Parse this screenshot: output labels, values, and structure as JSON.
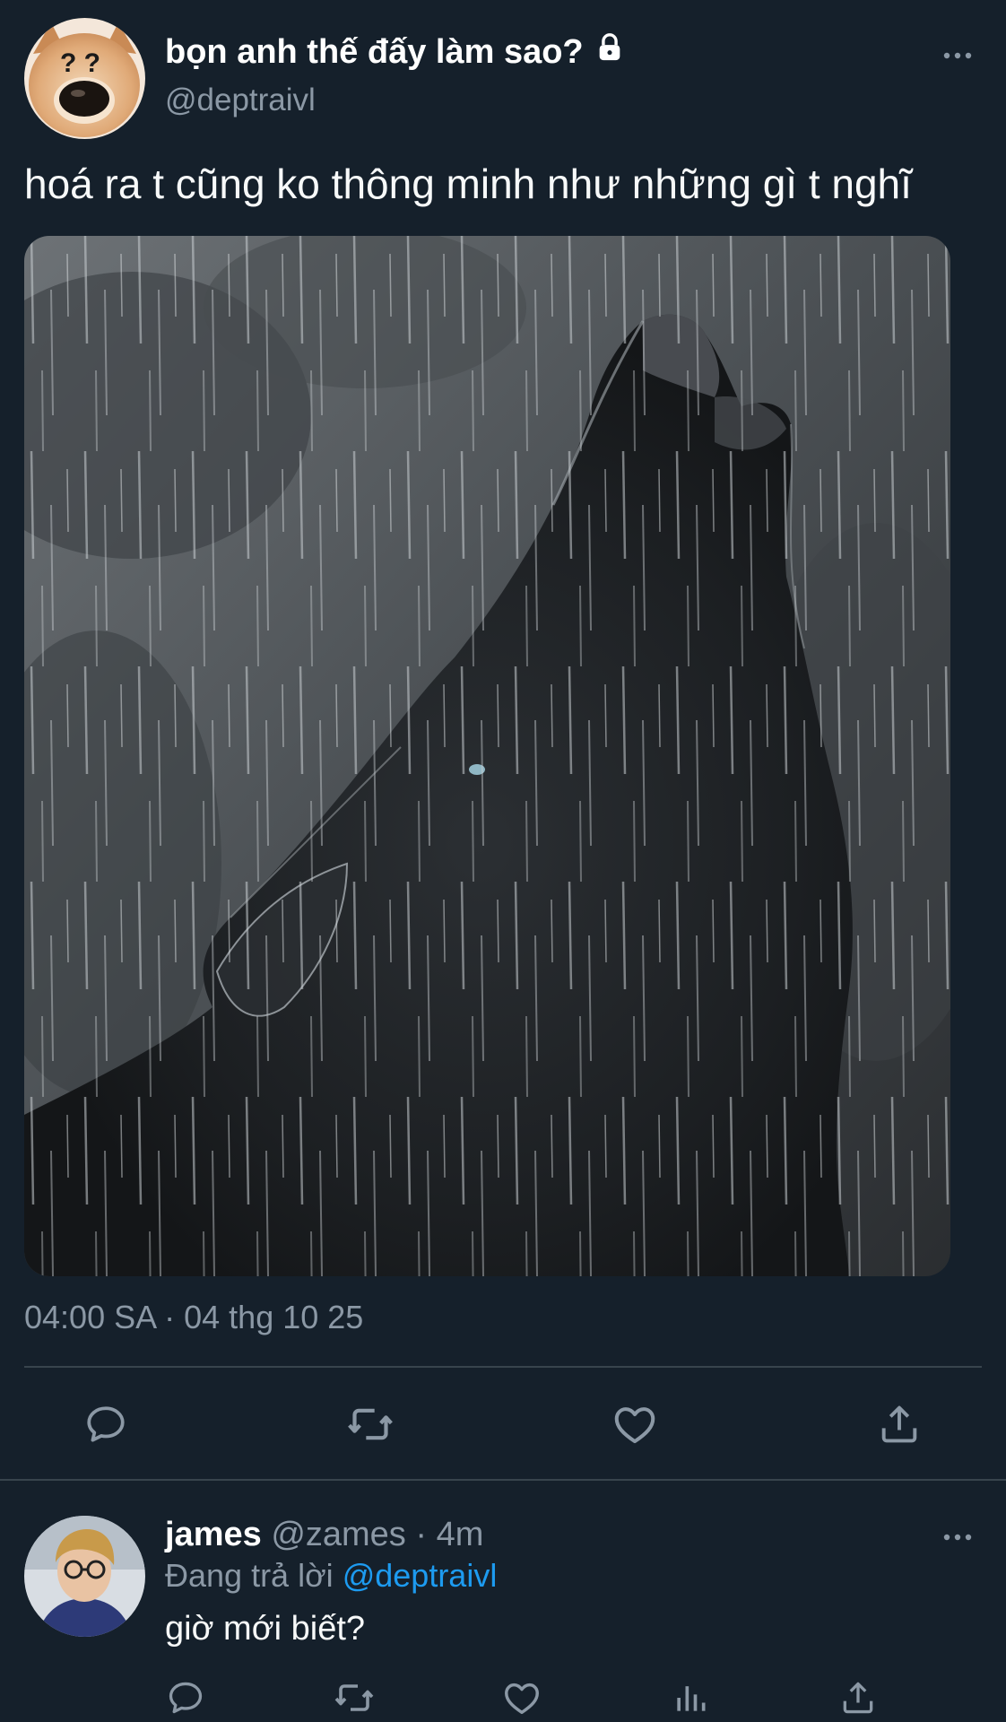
{
  "tweet": {
    "display_name": "bọn anh thế đấy làm sao?",
    "handle": "@deptraivl",
    "avatar_text": "? ?",
    "text": "hoá ra t cũng ko thông minh như những gì t nghĩ",
    "timestamp": "04:00 SA · 04 thg 10 25",
    "icons": {
      "locked": "lock-icon",
      "more": "more-icon",
      "reply": "reply-icon",
      "retweet": "retweet-icon",
      "like": "heart-icon",
      "share": "share-icon"
    }
  },
  "reply": {
    "display_name": "james",
    "handle_meta": "@zames · 4m",
    "replying_prefix": "Đang trả lời",
    "replying_mention": "@deptraivl",
    "text": "giờ mới biết?",
    "icons": {
      "reply": "reply-icon",
      "retweet": "retweet-icon",
      "like": "heart-icon",
      "stats": "stats-icon",
      "share": "share-icon"
    }
  },
  "colors": {
    "background": "#15202b",
    "secondary_text": "#8b98a5",
    "link": "#1d9bf0",
    "divider": "#38444d"
  }
}
